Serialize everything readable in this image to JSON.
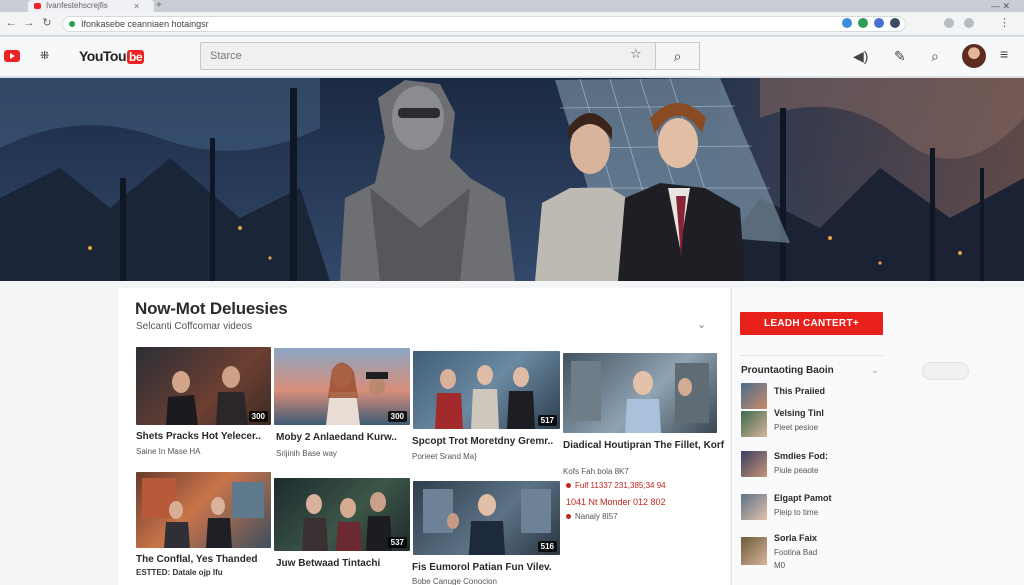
{
  "browser": {
    "tab_title": "Ivanfestehscrejfis",
    "tab_close": "×",
    "new_tab": "+",
    "window_controls": "— ✕",
    "url": "Ifonkasebe ceanniaen hotaingsr"
  },
  "header": {
    "wordmark": "YouTou",
    "wordmark_tube": "be",
    "search_placeholder": "Starce"
  },
  "section": {
    "title": "Now-Mot Deluesies",
    "subtitle": "Selcanti Coffcomar videos"
  },
  "videos": [
    {
      "title": "Shets Pracks Hot Yelecer..",
      "meta": "Saine In Mase HA",
      "duration": "300"
    },
    {
      "title": "Moby 2 Anlaedand Kurw..",
      "meta": "Srijinih Base way",
      "duration": "300"
    },
    {
      "title": "Spcopt Trot Moretdny Gremr..",
      "meta": "Porieet Srand Ma}",
      "duration": "517"
    },
    {
      "title": "Diadical Houtipran The Fillet, Korf",
      "meta": "Kofs Fah bola 8K7",
      "meta_red_1": "Fulf 11337 231,385;34 94",
      "meta_red_2": "1041 Nt Monder 012 802",
      "meta_red_3": "Nanaly 8I57",
      "duration": ""
    },
    {
      "title": "The Conflal, Yes Thanded",
      "meta": "ESTTED: Datale ojp Ifu",
      "duration": ""
    },
    {
      "title": "Juw Betwaad Tintachi",
      "meta": "",
      "duration": "537"
    },
    {
      "title": "Fis Eumorol Patian Fun Vilev.",
      "meta": "Bobe Canuge Conocion",
      "duration": "516"
    }
  ],
  "sidebar": {
    "subscribe_label": "LEADH CANTERT+",
    "heading": "Prountaoting Baoin",
    "items": [
      {
        "title": "This Praiied",
        "meta": ""
      },
      {
        "title": "Velsing Tinl",
        "meta": "Pieet pesioe"
      },
      {
        "title": "Smdies Fod:",
        "meta": "Piule peaote"
      },
      {
        "title": "Elgapt Pamot",
        "meta": "Pleip to time"
      },
      {
        "title": "Sorla Faix",
        "meta": "Footina Bad"
      },
      {
        "title": "",
        "meta": "M0"
      }
    ]
  },
  "colors": {
    "brand_red": "#e8201a",
    "meta_red": "#c0271d"
  }
}
